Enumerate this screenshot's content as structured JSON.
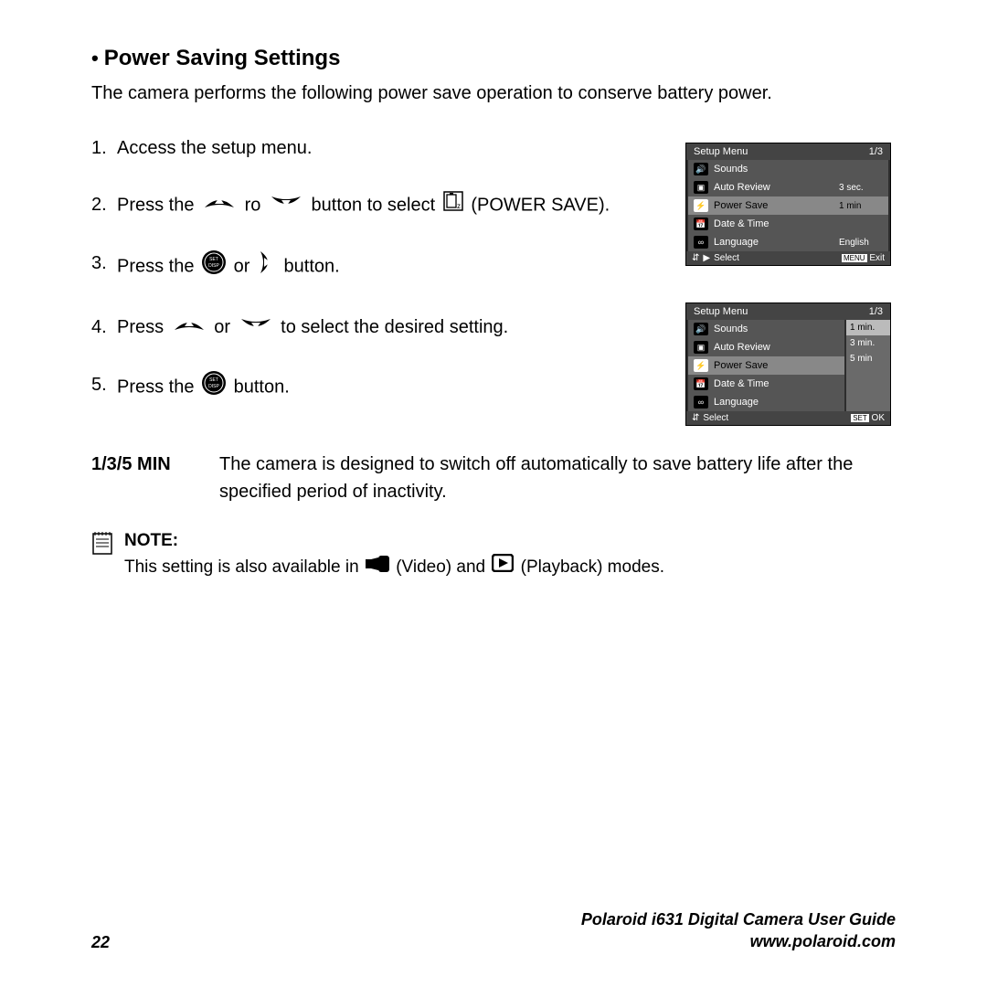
{
  "title": "Power Saving Settings",
  "intro": "The camera performs the following power save operation to conserve battery power.",
  "steps": {
    "s1": "Access the setup menu.",
    "s2a": "Press the",
    "s2b": "ro",
    "s2c": "button to select",
    "s2d": "(POWER SAVE).",
    "s3a": "Press the",
    "s3b": "or",
    "s3c": "button.",
    "s4a": "Press",
    "s4b": "or",
    "s4c": "to select the desired setting.",
    "s5a": "Press the",
    "s5b": "button."
  },
  "screen1": {
    "header_title": "Setup Menu",
    "header_page": "1/3",
    "rows": [
      {
        "label": "Sounds",
        "val": ""
      },
      {
        "label": "Auto Review",
        "val": "3 sec."
      },
      {
        "label": "Power Save",
        "val": "1 min"
      },
      {
        "label": "Date & Time",
        "val": ""
      },
      {
        "label": "Language",
        "val": "English"
      }
    ],
    "footer_left": "Select",
    "footer_right": "Exit",
    "footer_right_badge": "MENU"
  },
  "screen2": {
    "header_title": "Setup Menu",
    "header_page": "1/3",
    "rows": [
      {
        "label": "Sounds"
      },
      {
        "label": "Auto Review"
      },
      {
        "label": "Power Save"
      },
      {
        "label": "Date & Time"
      },
      {
        "label": "Language"
      }
    ],
    "options": [
      "1 min.",
      "3 min.",
      "5 min"
    ],
    "footer_left": "Select",
    "footer_right": "OK",
    "footer_right_badge": "SET"
  },
  "definition": {
    "term": "1/3/5 MIN",
    "body": "The camera is designed to switch off automatically to save battery life after the specified period of inactivity."
  },
  "note": {
    "label": "NOTE:",
    "body_a": "This setting is also available in",
    "body_b": "(Video) and",
    "body_c": "(Playback) modes."
  },
  "footer": {
    "page": "22",
    "guide": "Polaroid i631 Digital Camera User Guide",
    "url": "www.polaroid.com"
  }
}
